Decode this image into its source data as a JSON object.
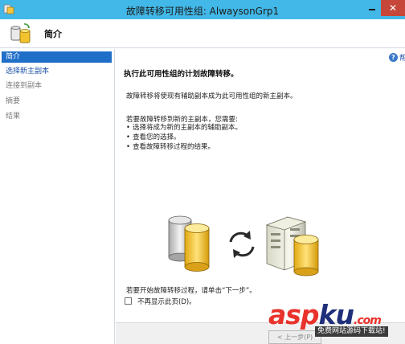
{
  "window": {
    "title": "故障转移可用性组: AlwaysonGrp1",
    "close_glyph": "✕"
  },
  "header": {
    "title": "简介"
  },
  "nav": {
    "items": [
      {
        "label": "简介",
        "state": "selected"
      },
      {
        "label": "选择新主副本",
        "state": "link"
      },
      {
        "label": "连接到副本",
        "state": "disabled"
      },
      {
        "label": "摘要",
        "state": "disabled"
      },
      {
        "label": "结果",
        "state": "disabled"
      }
    ]
  },
  "help": {
    "label": "帮",
    "icon": "help-icon"
  },
  "content": {
    "heading": "执行此可用性组的计划故障转移。",
    "description": "故障转移将使现有辅助副本成为此可用性组的新主副本。",
    "intro": "若要故障转移到新的主副本，您需要:",
    "bullets": [
      {
        "dot": "•",
        "text": "选择将成为新的主副本的辅助副本。"
      },
      {
        "dot": "•",
        "text": "查看您的选择。"
      },
      {
        "dot": "•",
        "text": "查看故障转移过程的结果。"
      }
    ],
    "footer_text": "若要开始故障转移过程，请单击“下一步”。",
    "checkbox_label": "不再显示此页(D)。",
    "checkbox_checked": false
  },
  "buttons": {
    "next": "< 上一步(P)"
  },
  "watermark": {
    "part1": "asp",
    "part2": "ku",
    "part3": ".com",
    "sub": "免费网站源码下载站!"
  },
  "colors": {
    "titlebar": "#42b8e8",
    "selected": "#1f6fc8",
    "link": "#1a4ea8",
    "close": "#c7463a"
  }
}
